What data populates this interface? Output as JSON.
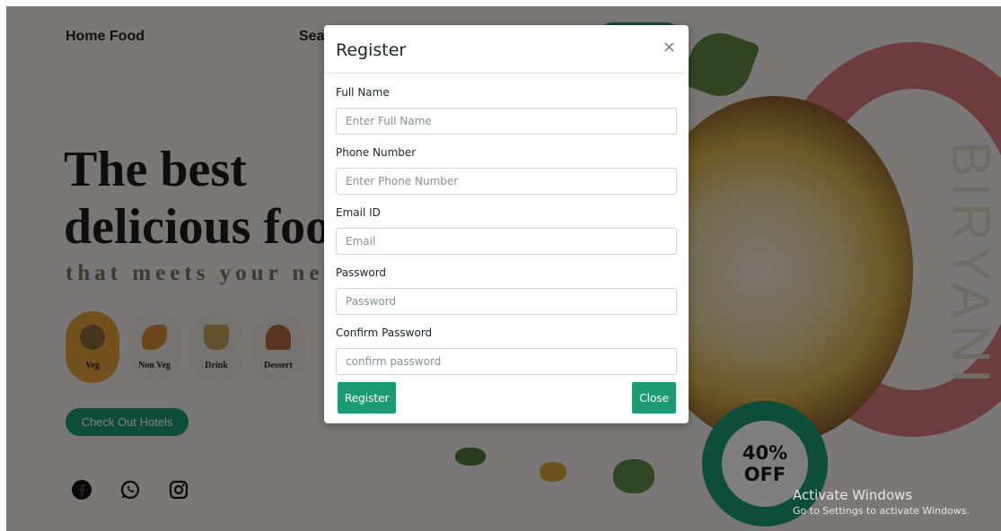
{
  "nav": {
    "brand": "Home Food",
    "search": "Sea"
  },
  "hero": {
    "title_line1": "The best",
    "title_line2": "delicious foo",
    "subtitle": "that meets your ne"
  },
  "categories": [
    {
      "label": "Veg",
      "icon": "veg-bowl-icon",
      "color": "#8a6a3b"
    },
    {
      "label": "Non Veg",
      "icon": "chicken-leg-icon",
      "color": "#d98a3a"
    },
    {
      "label": "Drink",
      "icon": "drink-glass-icon",
      "color": "#c9a35a"
    },
    {
      "label": "Dessert",
      "icon": "cupcake-icon",
      "color": "#b56a42"
    }
  ],
  "hotels_button": "Check Out Hotels",
  "social": [
    "facebook-icon",
    "whatsapp-icon",
    "instagram-icon"
  ],
  "promo": {
    "side_text": "BIRYANI",
    "badge_line1": "40%",
    "badge_line2": "OFF"
  },
  "modal": {
    "title": "Register",
    "close_symbol": "×",
    "fields": [
      {
        "label": "Full Name",
        "placeholder": "Enter Full Name"
      },
      {
        "label": "Phone Number",
        "placeholder": "Enter Phone Number"
      },
      {
        "label": "Email ID",
        "placeholder": "Email"
      },
      {
        "label": "Password",
        "placeholder": "Password"
      },
      {
        "label": "Confirm Password",
        "placeholder": "confirm password"
      }
    ],
    "register_button": "Register",
    "close_button": "Close"
  },
  "watermark": {
    "line1": "Activate Windows",
    "line2": "Go to Settings to activate Windows."
  },
  "colors": {
    "accent": "#1d9a74",
    "ring": "#d87a78",
    "active_category": "#e7a33a"
  }
}
